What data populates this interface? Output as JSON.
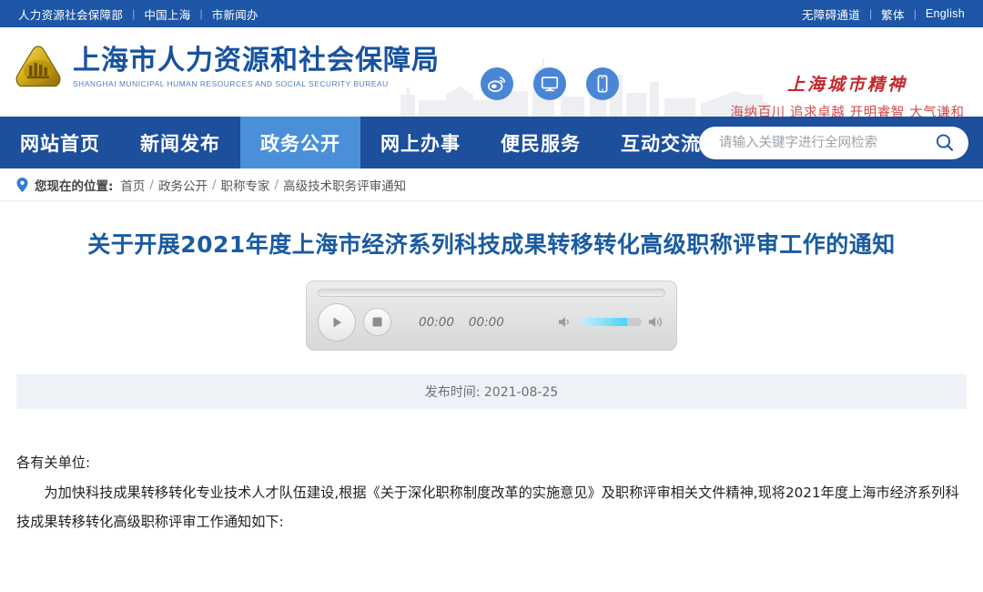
{
  "topbar": {
    "left_links": [
      "人力资源社会保障部",
      "中国上海",
      "市新闻办"
    ],
    "right_links": [
      "无障碍通道",
      "繁体",
      "English"
    ],
    "separator": "|",
    "background": "#1d56a6"
  },
  "header": {
    "brand_cn": "上海市人力资源和社会保障局",
    "brand_en": "SHANGHAI MUNICIPAL HUMAN RESOURCES AND SOCIAL SECURITY BUREAU",
    "logo_icon": "shanghai-hrss-emblem-icon",
    "icons": [
      {
        "name": "weibo-icon",
        "label": "微博"
      },
      {
        "name": "desktop-monitor-icon",
        "label": "网站"
      },
      {
        "name": "mobile-phone-icon",
        "label": "手机版"
      }
    ],
    "spirit_title": "上海城市精神",
    "spirit_subtitle": "海纳百川 追求卓越 开明睿智 大气谦和",
    "spirit_color": "#c0282d",
    "brand_color": "#17539e"
  },
  "nav": {
    "items": [
      {
        "label": "网站首页",
        "active": false
      },
      {
        "label": "新闻发布",
        "active": false
      },
      {
        "label": "政务公开",
        "active": true
      },
      {
        "label": "网上办事",
        "active": false
      },
      {
        "label": "便民服务",
        "active": false
      },
      {
        "label": "互动交流",
        "active": false
      }
    ],
    "background": "#1c4f9c",
    "active_background": "#4a90d9"
  },
  "search": {
    "placeholder": "请输入关键字进行全网检索",
    "value": "",
    "icon": "search-icon"
  },
  "breadcrumb": {
    "pin_icon": "location-pin-icon",
    "label": "您现在的位置:",
    "items": [
      "首页",
      "政务公开",
      "职称专家",
      "高级技术职务评审通知"
    ],
    "separator": "/"
  },
  "article": {
    "title": "关于开展2021年度上海市经济系列科技成果转移转化高级职称评审工作的通知",
    "publish_date_label": "发布时间:",
    "publish_date": "2021-08-25",
    "publish_date_line": "发布时间: 2021-08-25",
    "paragraphs": [
      "各有关单位:",
      "为加快科技成果转移转化专业技术人才队伍建设,根据《关于深化职称制度改革的实施意见》及职称评审相关文件精神,现将2021年度上海市经济系列科技成果转移转化高级职称评审工作通知如下:"
    ]
  },
  "audio_player": {
    "play_button": "play-icon",
    "stop_button": "stop-icon",
    "current_time": "00:00",
    "total_time": "00:00",
    "volume_low_icon": "volume-low-icon",
    "volume_high_icon": "volume-high-icon",
    "volume_percent": 76,
    "progress_percent": 0,
    "volume_fill_color": "#46d3f7"
  }
}
